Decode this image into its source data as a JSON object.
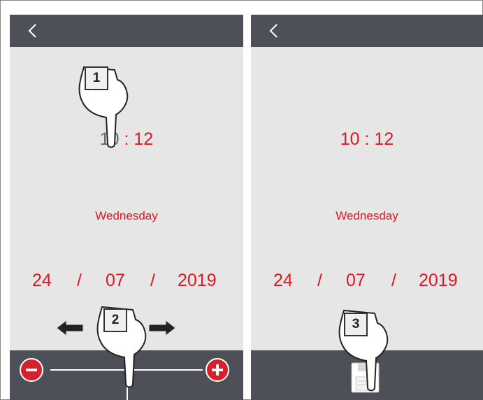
{
  "left_panel": {
    "time": {
      "hours": "10",
      "separator": " : ",
      "minutes": "12"
    },
    "weekday": "Wednesday",
    "date": {
      "day": "24",
      "sep1": "/",
      "month": "07",
      "sep2": "/",
      "year": "2019"
    },
    "step_label": "1",
    "step2_label": "2"
  },
  "right_panel": {
    "time": "10 : 12",
    "weekday": "Wednesday",
    "date": {
      "day": "24",
      "sep1": "/",
      "month": "07",
      "sep2": "/",
      "year": "2019"
    },
    "step_label": "3"
  },
  "icons": {
    "back": "chevron-left-icon",
    "minus": "minus-circle-icon",
    "plus": "plus-circle-icon",
    "save": "floppy-disk-icon",
    "pointer": "pointing-hand-icon",
    "arrow_left": "arrow-left-icon",
    "arrow_right": "arrow-right-icon"
  },
  "colors": {
    "accent": "#e3151f",
    "bar": "#4d5157",
    "panel": "#e6e6e6",
    "dim_text": "#666666"
  }
}
